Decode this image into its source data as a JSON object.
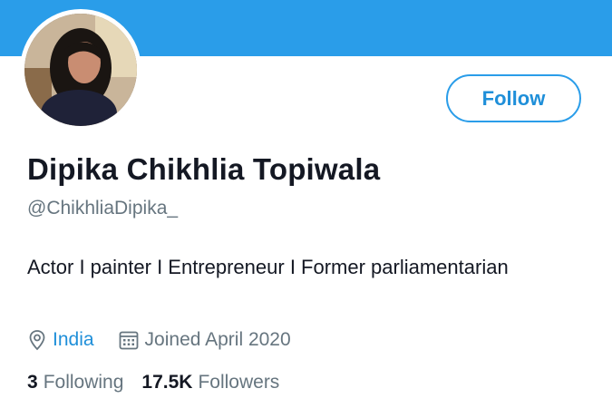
{
  "profile": {
    "name": "Dipika Chikhlia Topiwala",
    "handle": "@ChikhliaDipika_",
    "bio": "Actor I painter I Entrepreneur I Former parliamentarian",
    "location": "India",
    "joined": "Joined April 2020"
  },
  "actions": {
    "follow_label": "Follow"
  },
  "stats": {
    "following_count": "3",
    "following_label": "Following",
    "followers_count": "17.5K",
    "followers_label": "Followers"
  },
  "icons": {
    "location": "map-pin-icon",
    "joined": "calendar-icon"
  },
  "colors": {
    "banner": "#2a9de9",
    "accent": "#1f8fd9",
    "text": "#141823",
    "muted": "#66757f"
  }
}
